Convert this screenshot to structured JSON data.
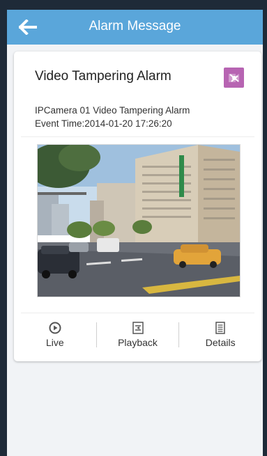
{
  "header": {
    "title": "Alarm Message",
    "back_icon": "back-arrow-icon"
  },
  "alarm": {
    "title": "Video Tampering Alarm",
    "type_icon": "video-tampering-icon",
    "description": "IPCamera 01 Video Tampering Alarm",
    "event_time": "Event Time:2014-01-20 17:26:20"
  },
  "actions": [
    {
      "label": "Live",
      "icon": "play-icon"
    },
    {
      "label": "Playback",
      "icon": "playback-icon"
    },
    {
      "label": "Details",
      "icon": "details-icon"
    }
  ],
  "colors": {
    "accent": "#5aa6da",
    "alarm_icon_bg": "#b764b2"
  }
}
